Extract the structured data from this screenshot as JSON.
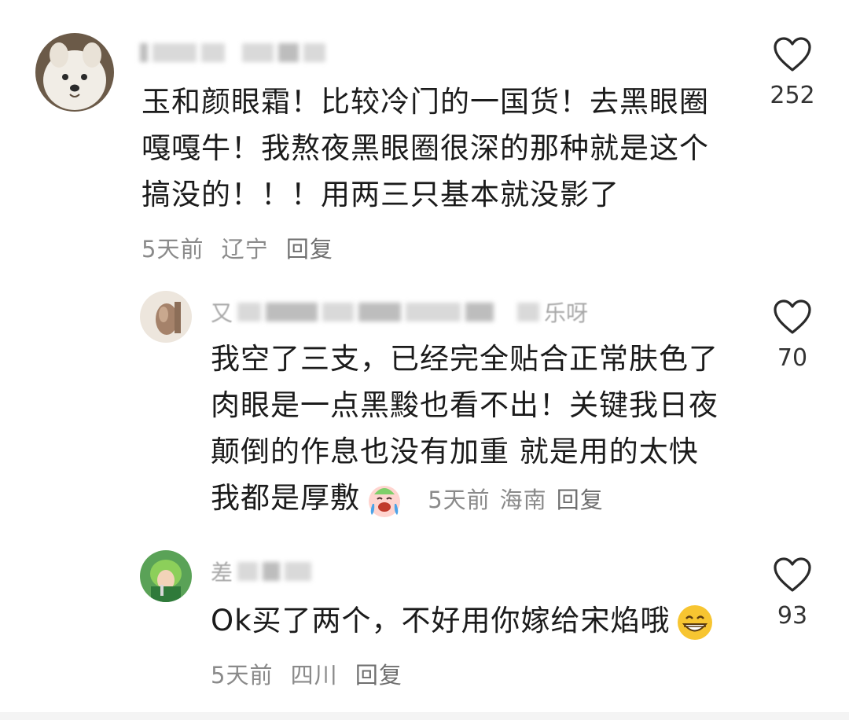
{
  "comments": [
    {
      "username_partial": "",
      "text_lines": [
        "玉和颜眼霜！比较冷门的一国货！去黑眼圈",
        "嘎嘎牛！我熬夜黑眼圈很深的那种就是这个",
        "搞没的！！！用两三只基本就没影了"
      ],
      "time": "5天前",
      "location": "辽宁",
      "reply_label": "回复",
      "likes": "252"
    },
    {
      "username_partial": "又",
      "username_tail": "乐呀",
      "text_lines": [
        "我空了三支，已经完全贴合正常肤色了",
        "肉眼是一点黑黢也看不出！关键我日夜",
        "颠倒的作息也没有加重 就是用的太快",
        "我都是厚敷"
      ],
      "emoji": "crying-laughing-emoji",
      "time": "5天前",
      "location": "海南",
      "reply_label": "回复",
      "likes": "70"
    },
    {
      "username_partial": "差",
      "text_lines": [
        "Ok买了两个，不好用你嫁给宋焰哦"
      ],
      "emoji": "grinning-emoji",
      "time": "5天前",
      "location": "四川",
      "reply_label": "回复",
      "likes": "93"
    }
  ],
  "icons": {
    "like": "heart-outline-icon"
  },
  "colors": {
    "text": "#1b1b1b",
    "meta": "#8a8a8a",
    "heart": "#2a2a2a"
  }
}
